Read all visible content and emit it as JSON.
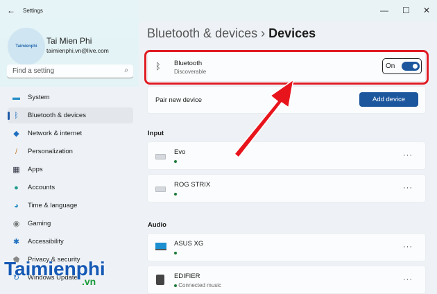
{
  "window": {
    "title": "Settings",
    "back_icon": "arrow-left-icon"
  },
  "profile": {
    "avatar_text": "Taimienphi",
    "name": "Tai Mien Phi",
    "email": "taimienphi.vn@live.com"
  },
  "search": {
    "placeholder": "Find a setting"
  },
  "nav": [
    {
      "label": "System",
      "icon": "system-icon"
    },
    {
      "label": "Bluetooth & devices",
      "icon": "bluetooth-icon",
      "selected": true
    },
    {
      "label": "Network & internet",
      "icon": "wifi-icon"
    },
    {
      "label": "Personalization",
      "icon": "brush-icon"
    },
    {
      "label": "Apps",
      "icon": "apps-icon"
    },
    {
      "label": "Accounts",
      "icon": "person-icon"
    },
    {
      "label": "Time & language",
      "icon": "globe-icon"
    },
    {
      "label": "Gaming",
      "icon": "gamepad-icon"
    },
    {
      "label": "Accessibility",
      "icon": "accessibility-icon"
    },
    {
      "label": "Privacy & security",
      "icon": "shield-icon"
    },
    {
      "label": "Windows Update",
      "icon": "update-icon"
    }
  ],
  "breadcrumb": {
    "parent": "Bluetooth & devices",
    "sep": "›",
    "current": "Devices"
  },
  "bluetooth": {
    "title": "Bluetooth",
    "status": "Discoverable",
    "toggle_label": "On",
    "toggle_on": true
  },
  "pair": {
    "label": "Pair new device",
    "button": "Add device"
  },
  "sections": {
    "input": "Input",
    "audio": "Audio"
  },
  "input_devices": [
    {
      "name": "Evo",
      "more": "···"
    },
    {
      "name": "ROG STRIX",
      "more": "···"
    }
  ],
  "audio_devices": [
    {
      "name": "ASUS XG",
      "status": "",
      "more": "···"
    },
    {
      "name": "EDIFIER",
      "status": "Connected music",
      "more": "···"
    }
  ],
  "watermark": {
    "brand": "Taimienphi",
    "tld": ".vn"
  },
  "colors": {
    "accent": "#1c579e",
    "highlight": "#e01b24"
  }
}
